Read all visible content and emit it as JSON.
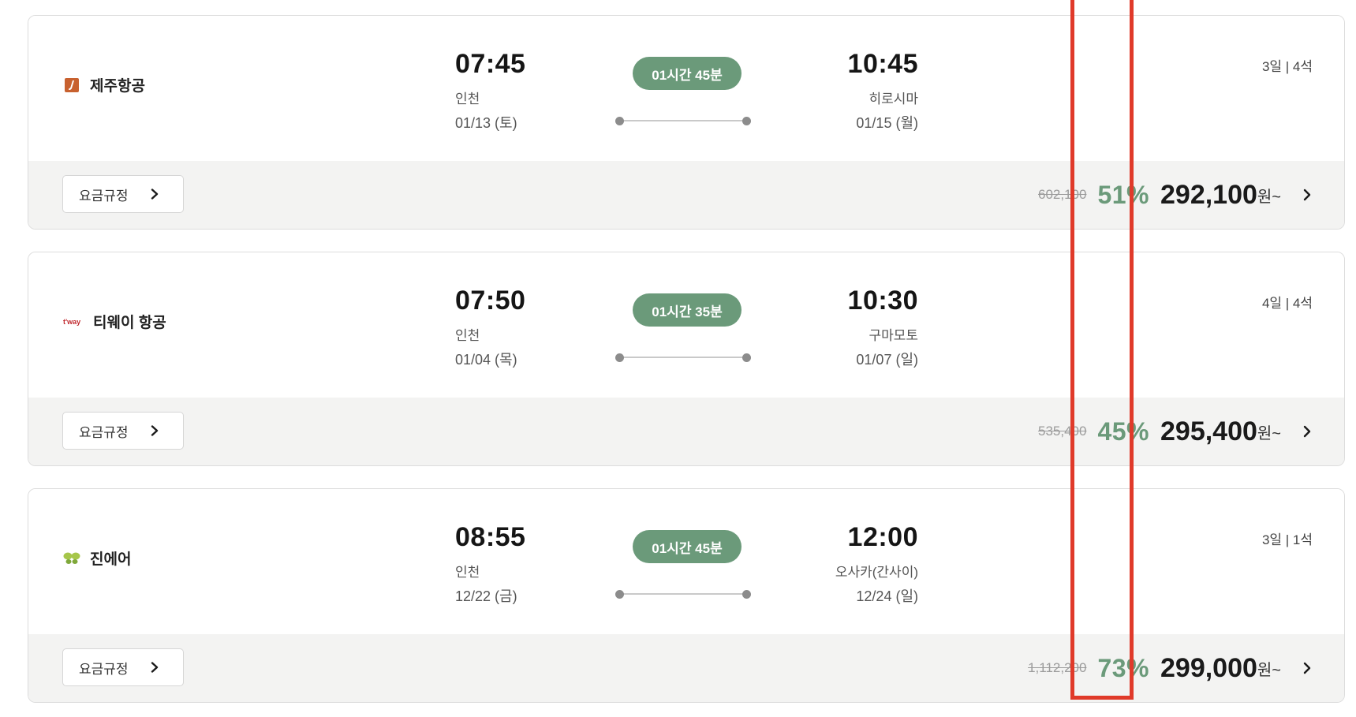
{
  "flights": [
    {
      "airline": "제주항공",
      "logo": "jeju-air-logo",
      "dep_time": "07:45",
      "dep_city": "인천",
      "dep_date": "01/13 (토)",
      "duration": "01시간 45분",
      "arr_time": "10:45",
      "arr_city": "히로시마",
      "arr_date": "01/15 (월)",
      "stay_seats": "3일 | 4석",
      "fare_rule_label": "요금규정",
      "original_price": "602,100",
      "discount": "51%",
      "price": "292,100",
      "price_suffix": "원~"
    },
    {
      "airline": "티웨이 항공",
      "logo": "tway-logo",
      "logo_text": "t'way",
      "dep_time": "07:50",
      "dep_city": "인천",
      "dep_date": "01/04 (목)",
      "duration": "01시간 35분",
      "arr_time": "10:30",
      "arr_city": "구마모토",
      "arr_date": "01/07 (일)",
      "stay_seats": "4일 | 4석",
      "fare_rule_label": "요금규정",
      "original_price": "535,400",
      "discount": "45%",
      "price": "295,400",
      "price_suffix": "원~"
    },
    {
      "airline": "진에어",
      "logo": "jinair-logo",
      "dep_time": "08:55",
      "dep_city": "인천",
      "dep_date": "12/22 (금)",
      "duration": "01시간 45분",
      "arr_time": "12:00",
      "arr_city": "오사카(간사이)",
      "arr_date": "12/24 (일)",
      "stay_seats": "3일 | 1석",
      "fare_rule_label": "요금규정",
      "original_price": "1,112,200",
      "discount": "73%",
      "price": "299,000",
      "price_suffix": "원~"
    }
  ],
  "colors": {
    "accent_green": "#6b9a7a",
    "highlight_red": "#e03a2a",
    "jeju_orange": "#c8612f",
    "tway_red": "#c0282d",
    "jinair_green": "#a6c64a"
  }
}
